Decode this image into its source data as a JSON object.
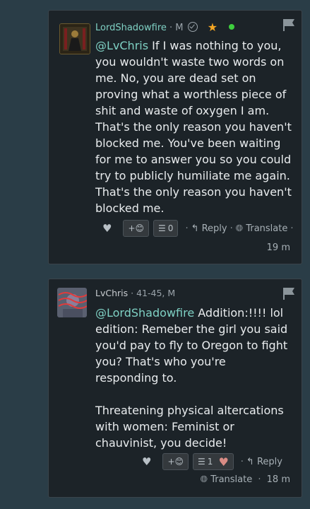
{
  "comments": [
    {
      "username": "LordShadowfire",
      "gender": "· M",
      "mention": "@LvChris",
      "text": " If I was nothing to you, you wouldn't waste two words on me. No, you are dead set on proving what a worthless piece of shit and waste of oxygen I am. That's the only reason you haven't blocked me. You've been waiting for me to answer you so you could try to publicly humiliate me again. That's the only reason you haven't blocked me.",
      "add_reaction": "+😊",
      "reaction_count": "0",
      "reply": "Reply",
      "translate": "Translate",
      "sep": "·",
      "time": "19 m"
    },
    {
      "username": "LvChris",
      "meta": "· 41-45, M",
      "mention": "@LordShadowfire",
      "text_line1": " Addition:!!!! lol edition: Remeber the girl you said you'd pay to fly to Oregon to fight you? That's who you're responding to.",
      "text_line2": "Threatening physical altercations with women: Feminist or chauvinist, you decide!",
      "add_reaction": "+😊",
      "reaction_count": "1",
      "reply": "Reply",
      "translate": "Translate",
      "sep": "·",
      "time": "18 m"
    }
  ],
  "colors": {
    "page_bg": "#2a3d47",
    "card_bg": "#1c2328",
    "username": "#7fd1c4",
    "star": "#f5a623",
    "online": "#3ecf3e"
  }
}
